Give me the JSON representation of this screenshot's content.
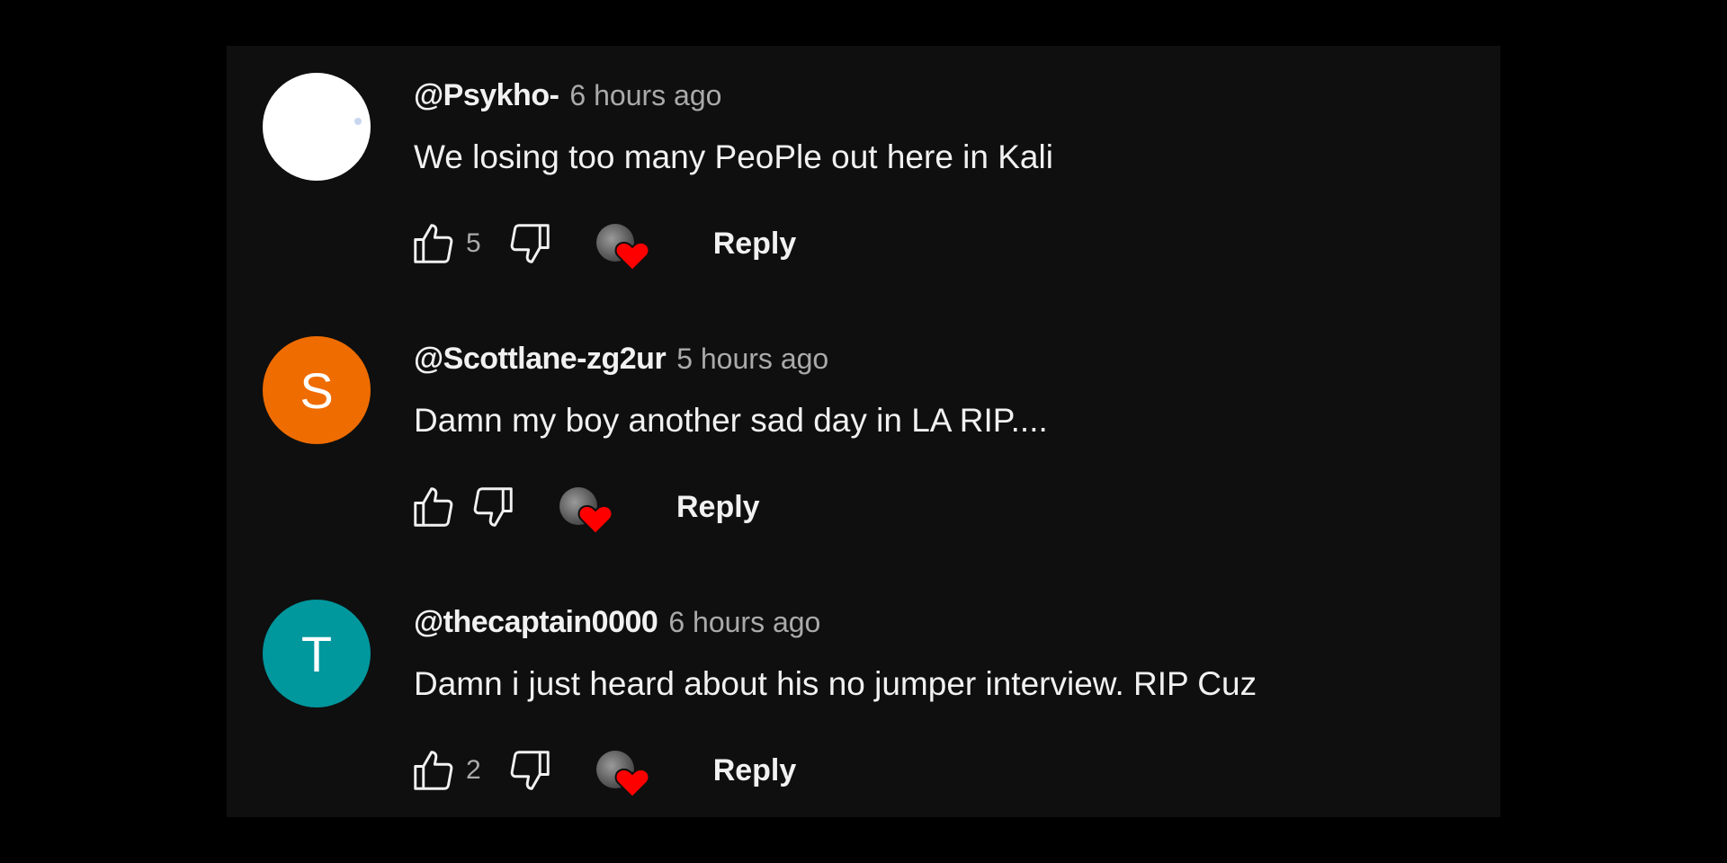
{
  "comments": [
    {
      "author": "@Psykho-",
      "time": "6 hours ago",
      "text": "We losing too many PeoPle out here in Kali",
      "avatar_letter": "",
      "avatar_color": "#ffffff",
      "likes": "5",
      "reply_label": "Reply"
    },
    {
      "author": "@Scottlane-zg2ur",
      "time": "5 hours ago",
      "text": "Damn my boy another sad day in LA RIP....",
      "avatar_letter": "S",
      "avatar_color": "#ef6c00",
      "likes": "",
      "reply_label": "Reply"
    },
    {
      "author": "@thecaptain0000",
      "time": "6 hours ago",
      "text": "Damn i just heard about his no jumper interview. RIP Cuz",
      "avatar_letter": "T",
      "avatar_color": "#00979d",
      "likes": "2",
      "reply_label": "Reply"
    }
  ],
  "icons": {
    "like": "thumbs-up-icon",
    "dislike": "thumbs-down-icon",
    "creator_heart": "heart-icon"
  },
  "colors": {
    "background": "#0f0f0f",
    "text": "#f1f1f1",
    "secondary_text": "#aaaaaa",
    "heart": "#ff0000"
  }
}
